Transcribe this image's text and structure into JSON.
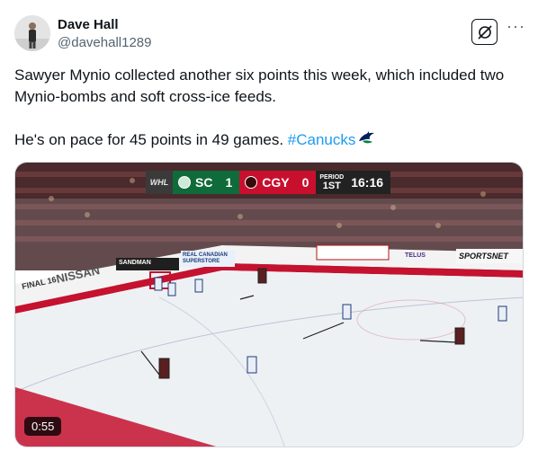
{
  "author": {
    "name": "Dave Hall",
    "handle": "@davehall1289"
  },
  "icons": {
    "follow": "grok-icon",
    "more": "more-icon",
    "emoji": "canucks-orca-icon"
  },
  "tweet": {
    "line1": "Sawyer Mynio collected another six points this week, which included two Mynio-bombs and soft cross-ice feeds.",
    "line2_prefix": "He's on pace for 45 points in 49 games. ",
    "hashtag": "#Canucks"
  },
  "video": {
    "duration": "0:55",
    "scorebug": {
      "league": "WHL",
      "team1": "SC",
      "score1": "1",
      "team2": "CGY",
      "score2": "0",
      "period_label": "PERIOD",
      "period": "1ST",
      "clock": "16:16"
    },
    "boards": {
      "nissan": "NISSAN",
      "final": "FINAL 16",
      "sandman": "SANDMAN",
      "superstore": "REAL CANADIAN SUPERSTORE",
      "telus": "TELUS",
      "sportsnet": "SPORTSNET"
    }
  },
  "colors": {
    "hashtag": "#1d9bf0",
    "sc_green": "#0f6b3a",
    "cgy_red": "#c8102e"
  }
}
